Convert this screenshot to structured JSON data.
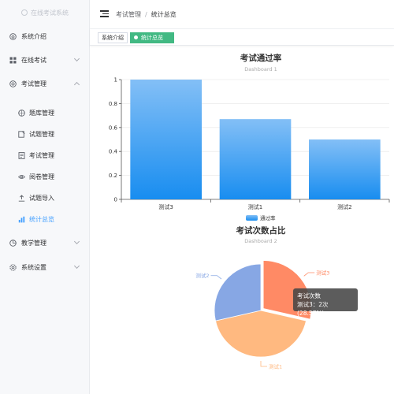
{
  "sidebar": {
    "brand": "在线考试系统",
    "items": [
      {
        "label": "系统介绍"
      },
      {
        "label": "在线考试"
      },
      {
        "label": "考试管理"
      },
      {
        "label": "教学管理"
      },
      {
        "label": "系统设置"
      }
    ],
    "sub_items": [
      {
        "label": "题库管理"
      },
      {
        "label": "试题管理"
      },
      {
        "label": "考试管理"
      },
      {
        "label": "阅卷管理"
      },
      {
        "label": "试题导入"
      },
      {
        "label": "统计总览"
      }
    ]
  },
  "header": {
    "breadcrumb": [
      "考试管理",
      "统计总览"
    ],
    "separator": "/"
  },
  "tags": [
    {
      "label": "系统介绍"
    },
    {
      "label": "统计总览"
    }
  ],
  "colors": {
    "accent": "#409eff",
    "tag_active": "#42b983",
    "bar_top": "#83bff6",
    "bar_bottom": "#188df0"
  },
  "tooltip": {
    "title": "考试次数",
    "line": "测试3：2次 (28.57%)"
  },
  "chart_data": [
    {
      "type": "bar",
      "title": "考试通过率",
      "subtitle": "Dashboard 1",
      "categories": [
        "测试3",
        "测试1",
        "测试2"
      ],
      "series": [
        {
          "name": "通过率",
          "values": [
            1,
            0.67,
            0.5
          ]
        }
      ],
      "ylim": [
        0,
        1
      ],
      "yticks": [
        "0",
        "0.2",
        "0.4",
        "0.6",
        "0.8",
        "1"
      ],
      "grid": true,
      "legend": "bottom-center"
    },
    {
      "type": "pie",
      "title": "考试次数占比",
      "subtitle": "Dashboard 2",
      "slices": [
        {
          "name": "测试3",
          "value": 2,
          "color": "#ff8a65"
        },
        {
          "name": "测试1",
          "value": 3,
          "color": "#ffb980"
        },
        {
          "name": "测试2",
          "value": 2,
          "color": "#87a7e4"
        }
      ]
    }
  ]
}
